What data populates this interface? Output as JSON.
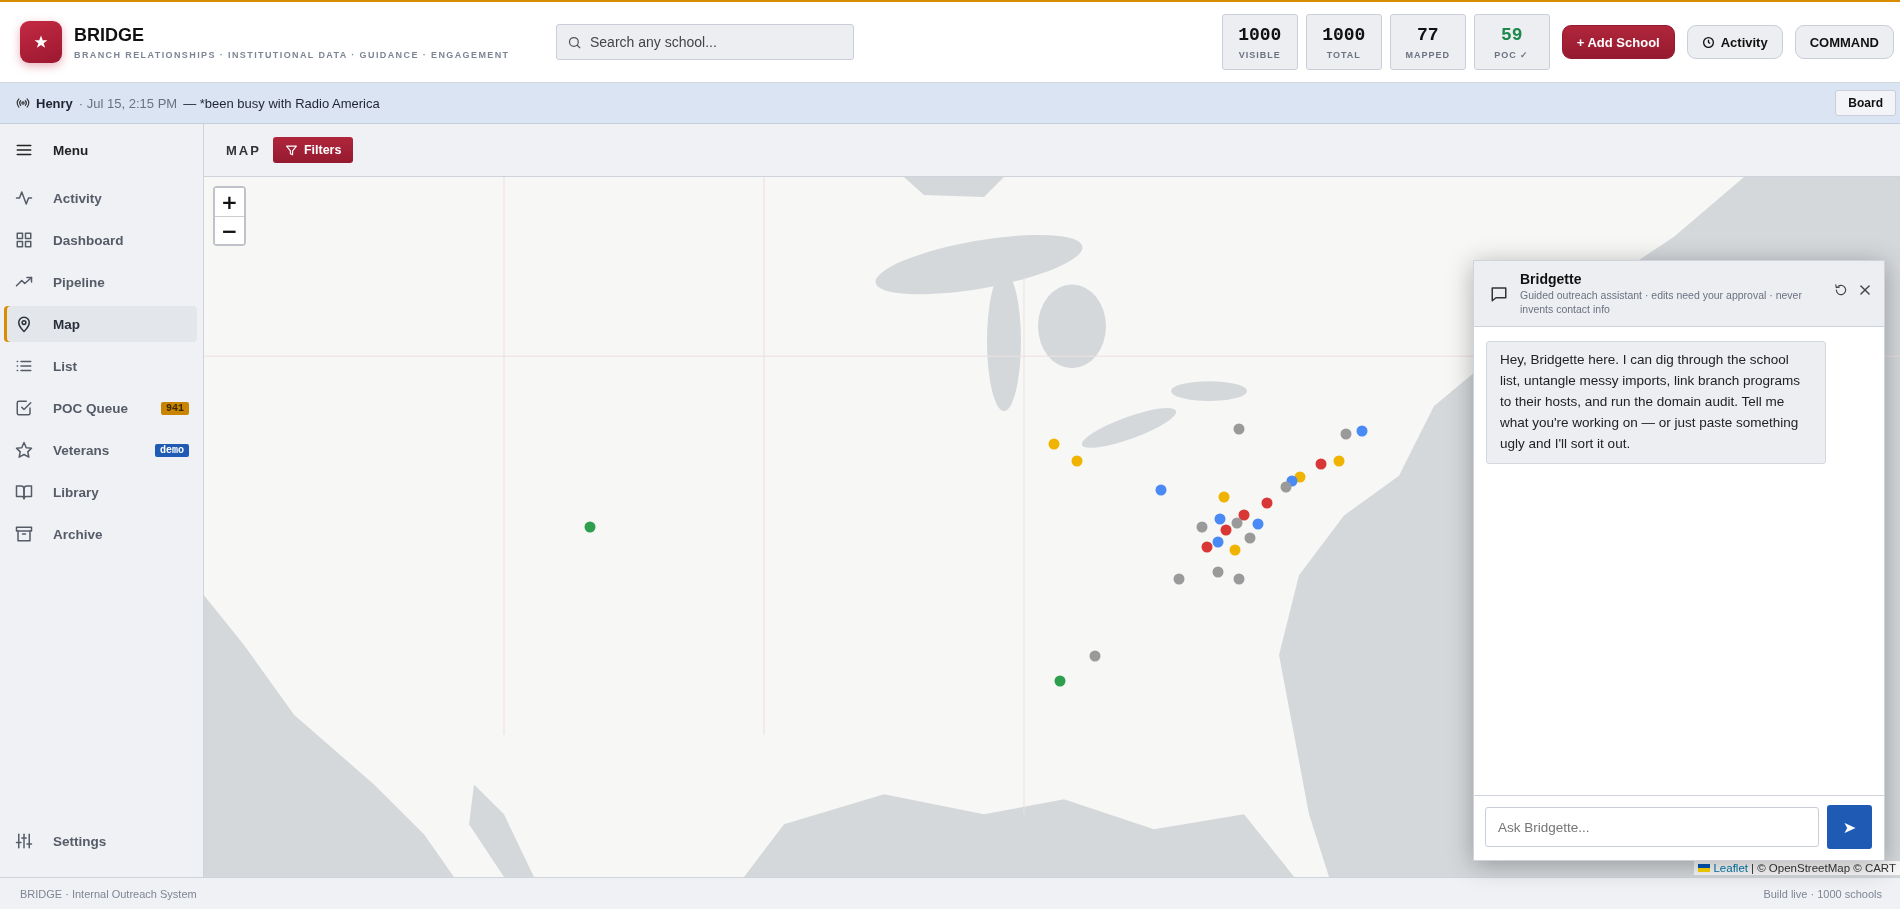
{
  "header": {
    "brand": {
      "title": "BRIDGE",
      "subtitle": "BRANCH RELATIONSHIPS · INSTITUTIONAL DATA · GUIDANCE · ENGAGEMENT"
    },
    "search": {
      "placeholder": "Search any school..."
    },
    "stats": [
      {
        "value": "1000",
        "label": "VISIBLE",
        "kind": "plain"
      },
      {
        "value": "1000",
        "label": "TOTAL",
        "kind": "plain"
      },
      {
        "value": "77",
        "label": "MAPPED",
        "kind": "plain"
      },
      {
        "value": "59",
        "label": "POC ✓",
        "kind": "positive"
      }
    ],
    "buttons": [
      {
        "label": "+ Add School",
        "kind": "primary"
      },
      {
        "label": "Activity",
        "kind": "clock"
      },
      {
        "label": "COMMAND",
        "kind": "plain"
      }
    ]
  },
  "banner": {
    "author": "Henry",
    "time": "· Jul 15, 2:15 PM",
    "message": "— *been busy with Radio America",
    "button": "Board"
  },
  "sidebar": {
    "title": "Menu",
    "items": [
      {
        "label": "Activity",
        "selected": false
      },
      {
        "label": "Dashboard",
        "selected": false
      },
      {
        "label": "Pipeline",
        "selected": false
      },
      {
        "label": "Map",
        "selected": true
      },
      {
        "label": "List",
        "selected": false
      },
      {
        "label": "POC Queue",
        "selected": false,
        "badge": {
          "text": "941",
          "kind": "count"
        }
      },
      {
        "label": "Veterans",
        "selected": false,
        "badge": {
          "text": "demo",
          "kind": "tag"
        }
      },
      {
        "label": "Library",
        "selected": false
      },
      {
        "label": "Archive",
        "selected": false
      }
    ],
    "settings": "Settings"
  },
  "toolbar": {
    "title": "MAP",
    "filters": "Filters"
  },
  "map": {
    "kind": "picture",
    "zoom_in": "+",
    "zoom_out": "−",
    "attribution_link": "Leaflet",
    "attribution_text": "| © OpenStreetMap © CART",
    "markers": [
      {
        "color": "#2e9e4f"
      },
      {
        "color": "#f0b400"
      },
      {
        "color": "#f0b400"
      },
      {
        "color": "#9a9a9a"
      },
      {
        "color": "#4a8af4"
      },
      {
        "color": "#9a9a9a"
      },
      {
        "color": "#4a8af4"
      },
      {
        "color": "#d93636"
      },
      {
        "color": "#f0b400"
      },
      {
        "color": "#f0b400"
      },
      {
        "color": "#4a8af4"
      },
      {
        "color": "#9a9a9a"
      },
      {
        "color": "#f0b400"
      },
      {
        "color": "#d93636"
      },
      {
        "color": "#d93636"
      },
      {
        "color": "#4a8af4"
      },
      {
        "color": "#9a9a9a"
      },
      {
        "color": "#d93636"
      },
      {
        "color": "#9a9a9a"
      },
      {
        "color": "#4a8af4"
      },
      {
        "color": "#4a8af4"
      },
      {
        "color": "#d93636"
      },
      {
        "color": "#9a9a9a"
      },
      {
        "color": "#f0b400"
      },
      {
        "color": "#9a9a9a"
      },
      {
        "color": "#9a9a9a"
      },
      {
        "color": "#9a9a9a"
      },
      {
        "color": "#9a9a9a"
      },
      {
        "color": "#2e9e4f"
      }
    ]
  },
  "chat": {
    "title": "Bridgette",
    "subtitle": "Guided outreach assistant · edits need your approval · never invents contact info",
    "messages": [
      "Hey, Bridgette here. I can dig through the school list, untangle messy imports, link branch programs to their hosts, and run the domain audit. Tell me what you're working on — or just paste something ugly and I'll sort it out."
    ],
    "input": {
      "placeholder": "Ask Bridgette..."
    },
    "send": "➤"
  },
  "footer": {
    "left": "BRIDGE · Internal Outreach System",
    "right": "Build live · 1000 schools"
  }
}
